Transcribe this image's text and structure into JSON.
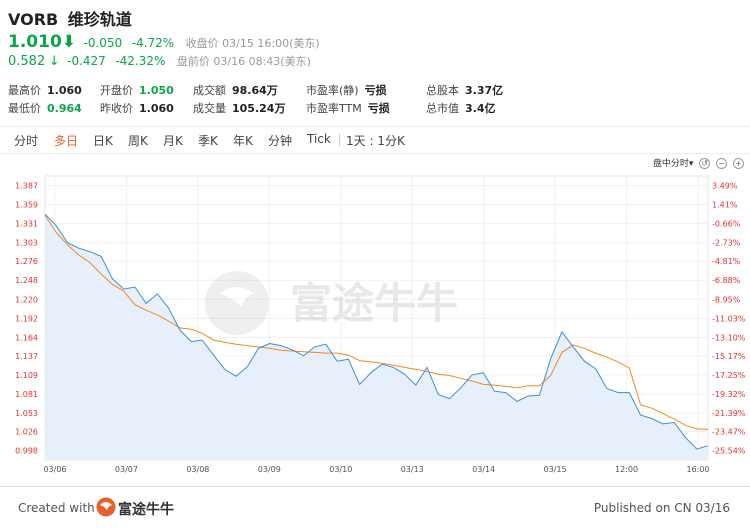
{
  "header": {
    "ticker": "VORB",
    "name": "维珍轨道"
  },
  "price": {
    "close_price": "1.010",
    "close_arrow": "⬇",
    "close_change": "-0.050",
    "close_change_pct": "-4.72%",
    "close_label": "收盘价 03/15 16:00(美东)",
    "pre_price": "0.582",
    "pre_arrow": "↓",
    "pre_change": "-0.427",
    "pre_change_pct": "-42.32%",
    "pre_label": "盘前价 03/16 08:43(美东)"
  },
  "stats": [
    {
      "label": "最高价",
      "value": "1.060",
      "green": false
    },
    {
      "label": "开盘价",
      "value": "1.050",
      "green": true
    },
    {
      "label": "成交额",
      "value": "98.64万",
      "green": false
    },
    {
      "label": "市盈率(静)",
      "value": "亏损",
      "green": false
    },
    {
      "label": "总股本",
      "value": "3.37亿",
      "green": false
    },
    {
      "label": "最低价",
      "value": "0.964",
      "green": true
    },
    {
      "label": "昨收价",
      "value": "1.060",
      "green": false
    },
    {
      "label": "成交量",
      "value": "105.24万",
      "green": false
    },
    {
      "label": "市盈率TTM",
      "value": "亏损",
      "green": false
    },
    {
      "label": "总市值",
      "value": "3.4亿",
      "green": false
    }
  ],
  "tabs": [
    "分时",
    "多日",
    "日K",
    "周K",
    "月K",
    "季K",
    "年K",
    "分钟",
    "Tick",
    "1天 : 1分K"
  ],
  "active_tab": 1,
  "toolbar": {
    "label": "盘中分时"
  },
  "colors": {
    "down": "#0aa648",
    "active_tab": "#e8602c",
    "price_line": "#3b8fd8",
    "avg_line": "#f08a1c",
    "area_fill": "#e6effa"
  },
  "watermark": "富途牛牛",
  "footer": {
    "created_with": "Created with",
    "brand": "富途牛牛",
    "published": "Published on CN 03/16"
  },
  "chart_data": {
    "type": "line",
    "y_ticks": [
      "1.387",
      "1.359",
      "1.331",
      "1.303",
      "1.276",
      "1.248",
      "1.220",
      "1.192",
      "1.164",
      "1.137",
      "1.109",
      "1.081",
      "1.053",
      "1.026",
      "0.998"
    ],
    "y_pct_ticks": [
      "3.49%",
      "1.41%",
      "-0.66%",
      "-2.73%",
      "-4.81%",
      "-6.88%",
      "-8.95%",
      "-11.03%",
      "-13.10%",
      "-15.17%",
      "-17.25%",
      "-19.32%",
      "-21.39%",
      "-23.47%",
      "-25.54%"
    ],
    "x_ticks": [
      "03/06",
      "03/07",
      "03/08",
      "03/09",
      "03/10",
      "03/13",
      "03/14",
      "03/15",
      "12:00",
      "16:00"
    ],
    "ylim": [
      0.984,
      1.401
    ],
    "price": [
      1.345,
      1.328,
      1.303,
      1.295,
      1.29,
      1.283,
      1.25,
      1.235,
      1.238,
      1.214,
      1.228,
      1.207,
      1.175,
      1.158,
      1.16,
      1.138,
      1.117,
      1.107,
      1.121,
      1.148,
      1.155,
      1.152,
      1.146,
      1.137,
      1.15,
      1.154,
      1.129,
      1.132,
      1.095,
      1.112,
      1.125,
      1.12,
      1.11,
      1.094,
      1.12,
      1.08,
      1.074,
      1.09,
      1.109,
      1.112,
      1.085,
      1.083,
      1.07,
      1.078,
      1.079,
      1.133,
      1.172,
      1.15,
      1.129,
      1.118,
      1.089,
      1.083,
      1.083,
      1.05,
      1.045,
      1.037,
      1.039,
      1.017,
      1.0,
      1.005
    ],
    "avg": [
      1.343,
      1.318,
      1.3,
      1.285,
      1.274,
      1.257,
      1.242,
      1.232,
      1.212,
      1.204,
      1.197,
      1.188,
      1.178,
      1.176,
      1.17,
      1.16,
      1.157,
      1.154,
      1.152,
      1.15,
      1.148,
      1.145,
      1.144,
      1.143,
      1.142,
      1.141,
      1.141,
      1.138,
      1.13,
      1.128,
      1.126,
      1.123,
      1.12,
      1.117,
      1.114,
      1.11,
      1.108,
      1.104,
      1.1,
      1.095,
      1.094,
      1.092,
      1.09,
      1.093,
      1.093,
      1.108,
      1.142,
      1.153,
      1.148,
      1.141,
      1.135,
      1.128,
      1.119,
      1.065,
      1.06,
      1.052,
      1.044,
      1.035,
      1.03,
      1.029
    ]
  }
}
